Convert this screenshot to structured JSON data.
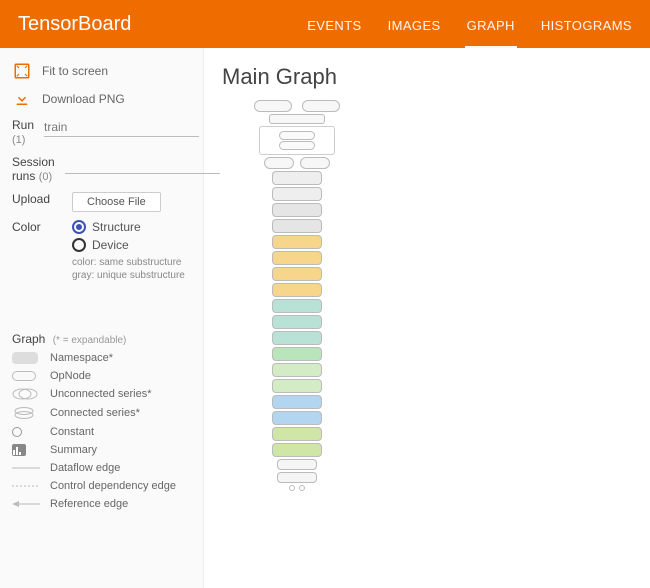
{
  "header": {
    "brand": "TensorBoard",
    "tabs": [
      "EVENTS",
      "IMAGES",
      "GRAPH",
      "HISTOGRAMS"
    ],
    "active_tab": 2
  },
  "sidebar": {
    "fit_label": "Fit to screen",
    "download_label": "Download PNG",
    "run": {
      "label": "Run",
      "count": "(1)",
      "value": "train"
    },
    "session": {
      "label": "Session runs",
      "count": "(0)",
      "value": ""
    },
    "upload": {
      "label": "Upload",
      "button": "Choose File"
    },
    "color": {
      "label": "Color",
      "options": [
        "Structure",
        "Device"
      ],
      "selected": 0,
      "hint1": "color: same substructure",
      "hint2": "gray: unique substructure"
    },
    "legend": {
      "title": "Graph",
      "note": "(* = expandable)",
      "items": [
        "Namespace*",
        "OpNode",
        "Unconnected series*",
        "Connected series*",
        "Constant",
        "Summary",
        "Dataflow edge",
        "Control dependency edge",
        "Reference edge"
      ]
    }
  },
  "main": {
    "title": "Main Graph"
  },
  "graph_nodes": [
    {
      "color": "#eeeeee"
    },
    {
      "color": "#eeeeee"
    },
    {
      "color": "#e5e5e5"
    },
    {
      "color": "#e5e5e5"
    },
    {
      "color": "#f7d58b"
    },
    {
      "color": "#f7d58b"
    },
    {
      "color": "#f7d58b"
    },
    {
      "color": "#f7d58b"
    },
    {
      "color": "#b9e2d6"
    },
    {
      "color": "#b9e2d6"
    },
    {
      "color": "#b9e2d6"
    },
    {
      "color": "#b9e5bb"
    },
    {
      "color": "#d4ecc6"
    },
    {
      "color": "#d4ecc6"
    },
    {
      "color": "#b2d5f0"
    },
    {
      "color": "#b2d5f0"
    },
    {
      "color": "#cfe6a7"
    },
    {
      "color": "#cfe6a7"
    }
  ]
}
